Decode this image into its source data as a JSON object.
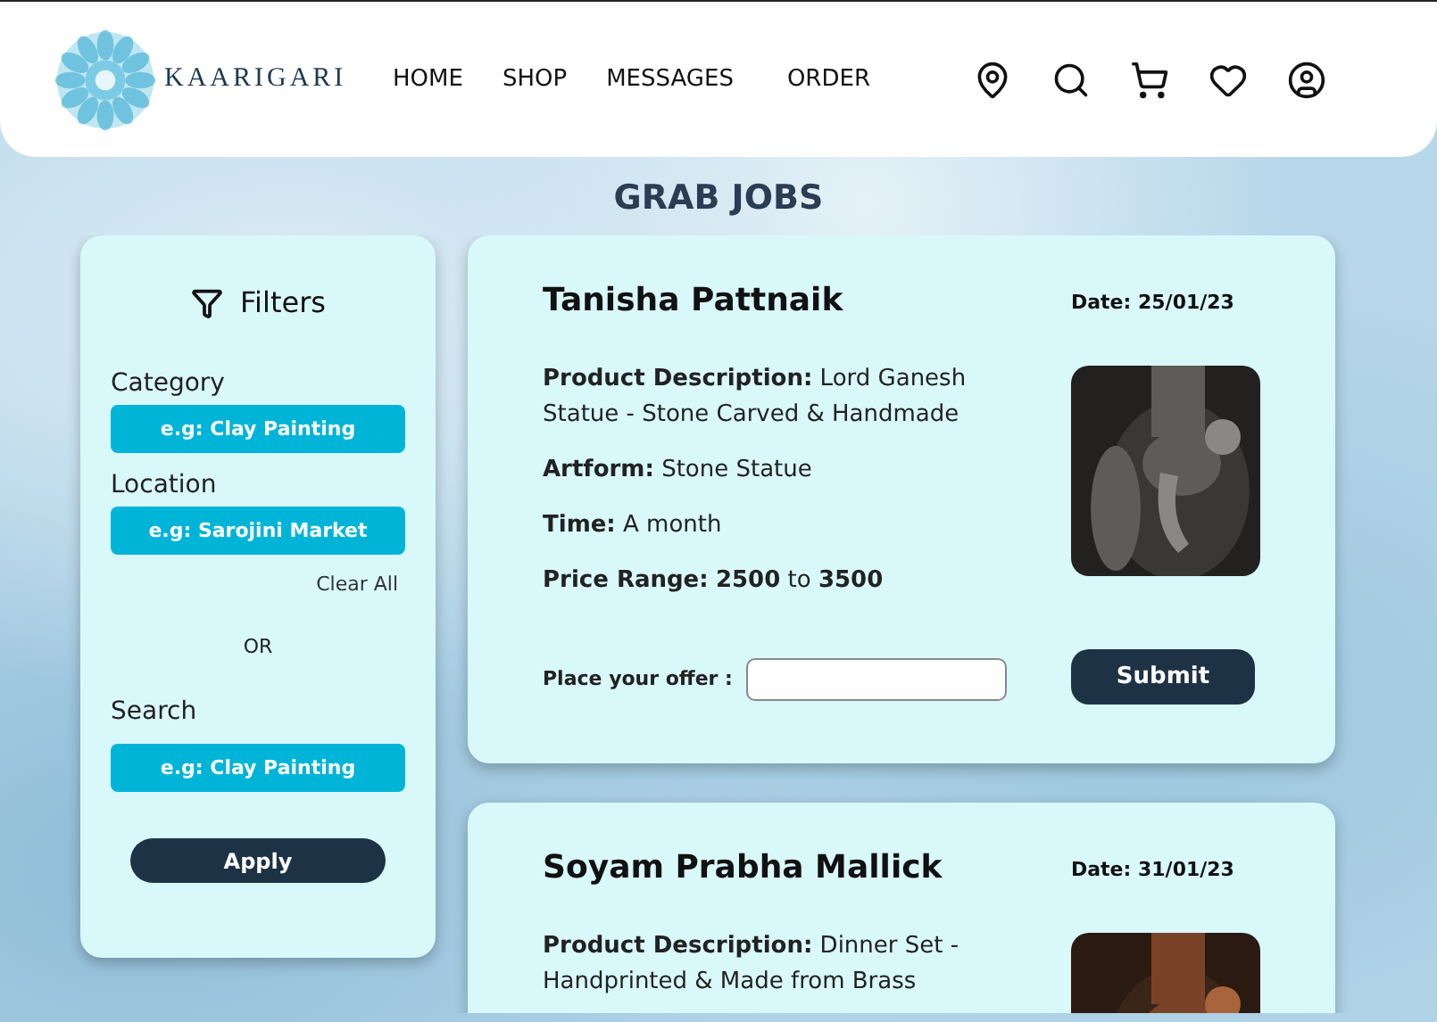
{
  "header": {
    "logo": "KAARIGARI",
    "nav": [
      {
        "label": "HOME"
      },
      {
        "label": "SHOP"
      },
      {
        "label": "MESSAGES"
      },
      {
        "label": "ORDER"
      }
    ],
    "icons": [
      {
        "kind": "location"
      },
      {
        "kind": "search"
      },
      {
        "kind": "cart"
      },
      {
        "kind": "heart"
      },
      {
        "kind": "user"
      }
    ]
  },
  "title": "GRAB JOBS",
  "filters": {
    "title": "Filters",
    "fields": [
      {
        "label": "Category",
        "placeholder": "e.g: Clay Painting"
      },
      {
        "label": "Location",
        "placeholder": "e.g: Sarojini Market"
      }
    ],
    "clear": "Clear All",
    "or": "OR",
    "search": {
      "label": "Search",
      "placeholder": "e.g: Clay Painting"
    },
    "apply": "Apply"
  },
  "jobs": [
    {
      "name": "Tanisha Pattnaik",
      "date": "Date: 25/01/23",
      "details": [
        "**Product Description:** Lord Ganesh Statue - Stone Carved & Handmade",
        "**Artform:** Stone Statue",
        "**Time:** A month",
        "**Price Range:** **2500** to **3500**"
      ],
      "offer_label": "Place your offer :",
      "submit": "Submit",
      "picture": {
        "kind": "picture"
      }
    },
    {
      "name": "Soyam Prabha Mallick",
      "date": "Date: 31/01/23",
      "details": [
        "**Product Description:** Dinner Set - Handprinted & Made from Brass"
      ],
      "picture": {
        "kind": "picture"
      }
    }
  ]
}
